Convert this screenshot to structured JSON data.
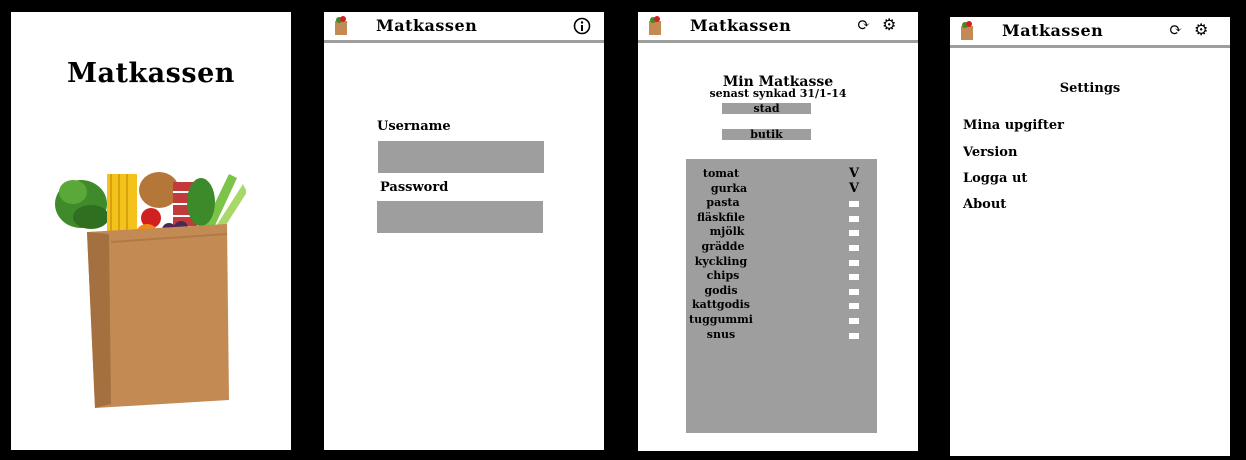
{
  "splash": {
    "title": "Matkassen"
  },
  "login": {
    "app_title": "Matkassen",
    "username_label": "Username",
    "username_value": "",
    "password_label": "Password",
    "password_value": "",
    "info_icon": "info-icon"
  },
  "list_screen": {
    "app_title": "Matkassen",
    "heading": "Min Matkasse",
    "sync_text": "senast synkad 31/1-14",
    "city_button": "stad",
    "store_button": "butik",
    "items": [
      {
        "name": "tomat",
        "checked": true
      },
      {
        "name": "gurka",
        "checked": true
      },
      {
        "name": "pasta",
        "checked": false
      },
      {
        "name": "fläskfile",
        "checked": false
      },
      {
        "name": "mjölk",
        "checked": false
      },
      {
        "name": "grädde",
        "checked": false
      },
      {
        "name": "kyckling",
        "checked": false
      },
      {
        "name": "chips",
        "checked": false
      },
      {
        "name": "godis",
        "checked": false
      },
      {
        "name": "kattgodis",
        "checked": false
      },
      {
        "name": "tuggummi",
        "checked": false
      },
      {
        "name": "snus",
        "checked": false
      }
    ],
    "check_mark": "V"
  },
  "settings_screen": {
    "app_title": "Matkassen",
    "heading": "Settings",
    "menu": [
      "Mina upgifter",
      "Version",
      "Logga ut",
      "About"
    ]
  },
  "icons": {
    "sync": "sync-icon",
    "gear": "gear-icon",
    "bag": "grocery-bag-icon"
  }
}
